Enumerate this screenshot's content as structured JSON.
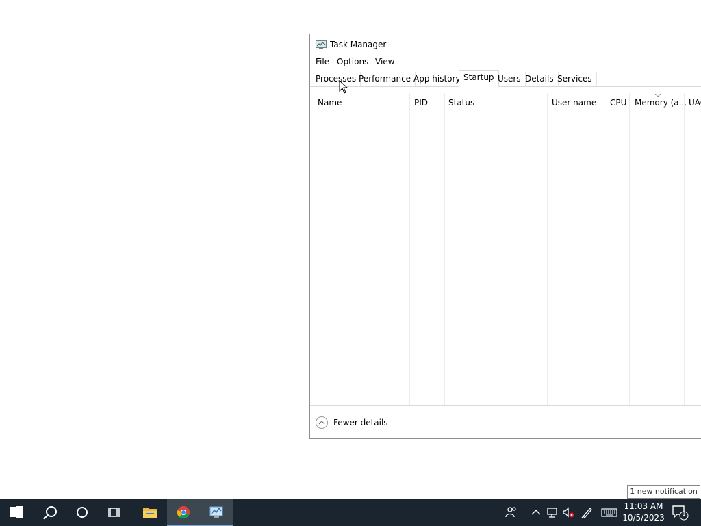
{
  "window": {
    "title": "Task Manager",
    "menu": [
      "File",
      "Options",
      "View"
    ],
    "tabs": [
      "Processes",
      "Performance",
      "App history",
      "Startup",
      "Users",
      "Details",
      "Services"
    ],
    "active_tab": "Startup",
    "columns": [
      "Name",
      "PID",
      "Status",
      "User name",
      "CPU",
      "Memory (a...",
      "UAC"
    ],
    "footer_label": "Fewer details"
  },
  "notification": {
    "text": "1 new notification"
  },
  "taskbar": {
    "clock_time": "11:03 AM",
    "clock_date": "10/5/2023",
    "notification_count": "1"
  }
}
